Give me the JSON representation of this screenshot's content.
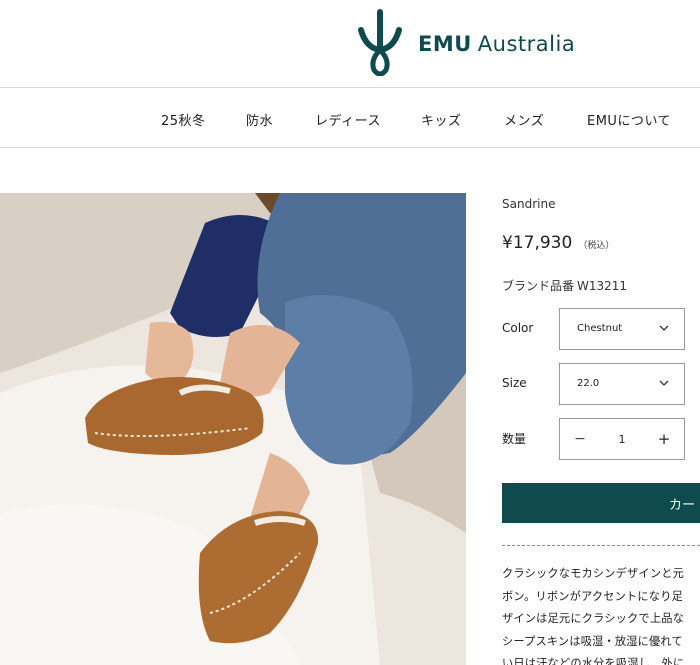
{
  "brand": {
    "logo_icon": "emu-leaf-logo-icon",
    "name_bold": "EMU",
    "name_rest": "Australia",
    "color": "#0f4a4f"
  },
  "nav": {
    "items": [
      "25秋冬",
      "防水",
      "レディース",
      "キッズ",
      "メンズ",
      "EMUについて"
    ]
  },
  "product": {
    "name": "Sandrine",
    "price": "¥17,930",
    "tax_note": "（税込）",
    "sku_label": "ブランド品番",
    "sku": "W13211",
    "color_label": "Color",
    "color_value": "Chestnut",
    "size_label": "Size",
    "size_value": "22.0",
    "qty_label": "数量",
    "qty_value": "1",
    "qty_minus": "−",
    "qty_plus": "+",
    "cart_label": "カー",
    "description": [
      "クラシックなモカシンデザインと元",
      "ボン。リボンがアクセントになり足",
      "ザインは足元にクラシックで上品な",
      "シープスキンは吸湿・放湿に優れて",
      "い日は汗などの水分を吸湿し、外に"
    ]
  }
}
